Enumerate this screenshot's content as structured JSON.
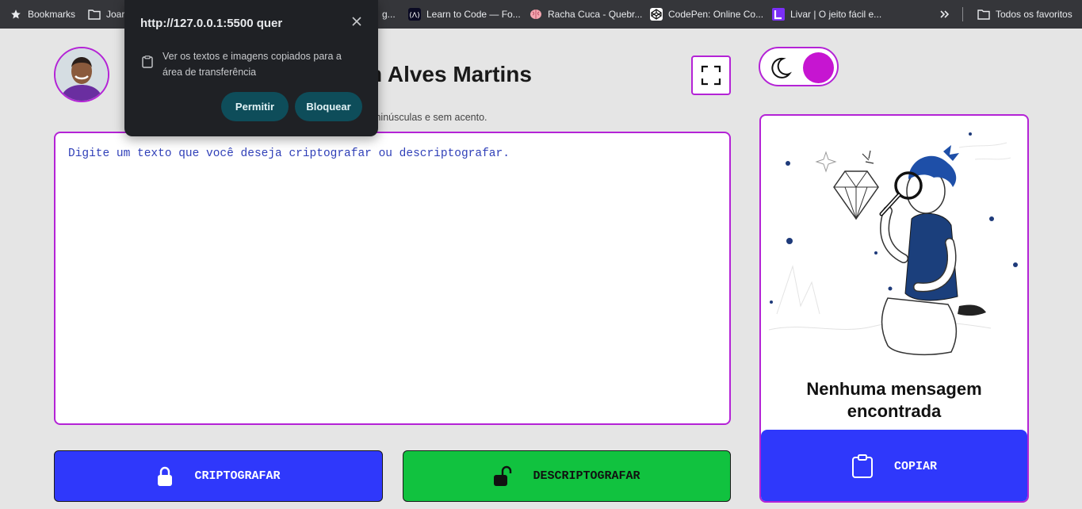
{
  "bookmarks_bar": {
    "items": [
      {
        "label": "Bookmarks",
        "icon": "star-icon"
      },
      {
        "label": "Joar",
        "icon": "folder-icon"
      },
      {
        "label": "g...",
        "icon": "page-icon"
      },
      {
        "label": "Learn to Code — Fo...",
        "icon": "freecodecamp-icon"
      },
      {
        "label": "Racha Cuca - Quebr...",
        "icon": "brain-icon"
      },
      {
        "label": "CodePen: Online Co...",
        "icon": "codepen-icon"
      },
      {
        "label": "Livar | O jeito fácil e...",
        "icon": "livar-icon"
      }
    ],
    "overflow_icon": "double-chevron-icon",
    "all_favorites": {
      "label": "Todos os favoritos",
      "icon": "folder-icon"
    }
  },
  "popup": {
    "title": "http://127.0.0.1:5500 quer",
    "permission_text": "Ver os textos e imagens copiados para a área de transferência",
    "allow_label": "Permitir",
    "block_label": "Bloquear"
  },
  "header": {
    "title_visible": "n Alves Martins",
    "hint_visible": "minúsculas e sem acento."
  },
  "input": {
    "placeholder": "Digite um texto que você deseja criptografar ou descriptografar."
  },
  "actions": {
    "encrypt_label": "CRIPTOGRAFAR",
    "decrypt_label": "DESCRIPTOGRAFAR"
  },
  "result": {
    "empty_title": "Nenhuma mensagem encontrada",
    "copy_label": "COPIAR"
  },
  "colors": {
    "accent": "#b423d6",
    "toggle_knob": "#c615d1",
    "encrypt_bg": "#2f38fb",
    "decrypt_bg": "#11c23f",
    "placeholder_text": "#2f3fb8"
  }
}
